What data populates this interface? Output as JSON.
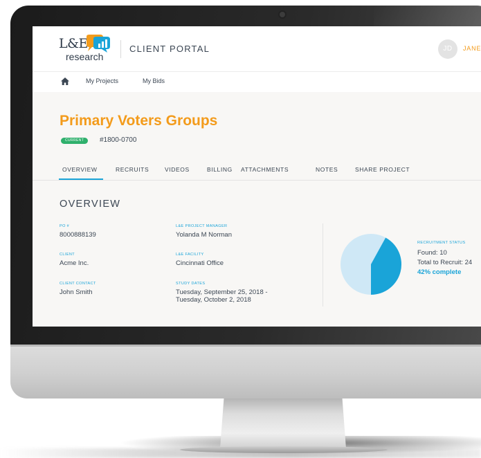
{
  "header": {
    "logo_text": "L&E",
    "logo_subtext": "research",
    "portal_title": "CLIENT PORTAL",
    "avatar_initials": "JD",
    "user_name": "JANE"
  },
  "nav": {
    "items": [
      "My Projects",
      "My Bids"
    ]
  },
  "project": {
    "title": "Primary Voters Groups",
    "status_badge": "CURRENT",
    "number": "#1800-0700"
  },
  "tabs": [
    "OVERVIEW",
    "RECRUITS",
    "VIDEOS",
    "BILLING",
    "ATTACHMENTS",
    "NOTES",
    "SHARE PROJECT"
  ],
  "active_tab": "OVERVIEW",
  "overview": {
    "heading": "OVERVIEW",
    "fields": {
      "po": {
        "label": "PO #",
        "value": "8000888139"
      },
      "client": {
        "label": "CLIENT",
        "value": "Acme Inc."
      },
      "client_contact": {
        "label": "CLIENT CONTACT",
        "value": "John Smith"
      },
      "project_manager": {
        "label": "L&E PROJECT MANAGER",
        "value": "Yolanda M Norman"
      },
      "facility": {
        "label": "L&E FACILITY",
        "value": "Cincinnati Office"
      },
      "study_dates": {
        "label": "STUDY DATES",
        "value_line1": "Tuesday, September 25, 2018 -",
        "value_line2": "Tuesday, October 2, 2018"
      }
    }
  },
  "recruitment": {
    "label": "RECRUITMENT STATUS",
    "found_text": "Found: 10",
    "total_text": "Total to Recruit: 24",
    "percent_text": "42% complete",
    "found": 10,
    "total": 24,
    "fraction_complete": 0.42
  },
  "colors": {
    "brand_orange": "#f39b1b",
    "accent_blue": "#1aa4d8",
    "pie_remaining": "#cfe8f6",
    "status_green": "#2fb06c",
    "text_dark": "#3b4653"
  },
  "icons": {
    "home": "home-icon",
    "logo_mark": "speech-bubble-chart-icon"
  }
}
